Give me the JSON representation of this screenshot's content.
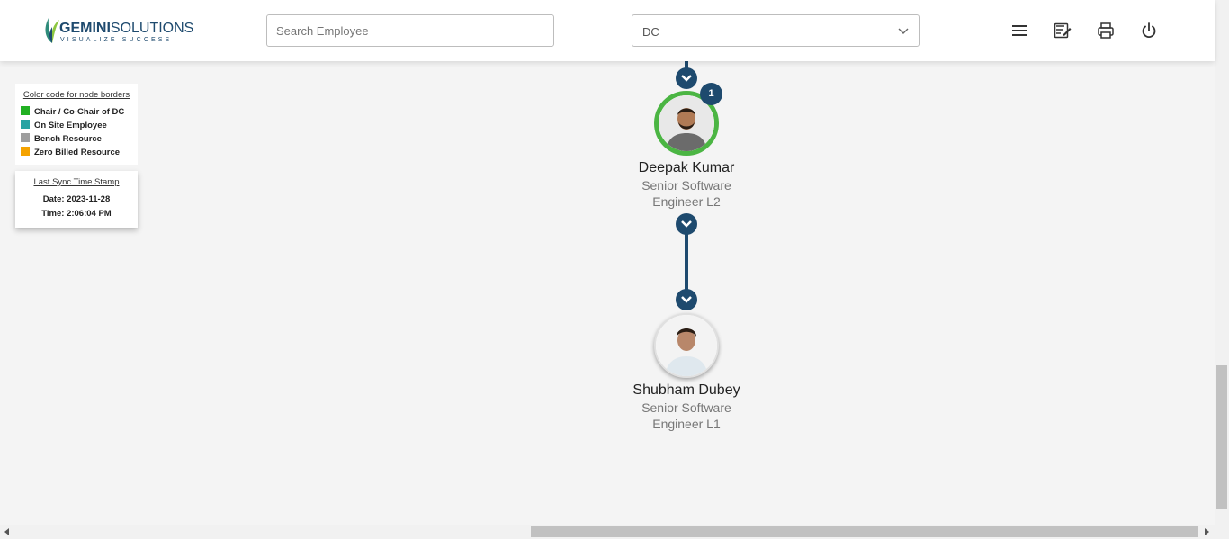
{
  "header": {
    "logo_main": "GEMINI",
    "logo_main2": "SOLUTIONS",
    "logo_sub": "VISUALIZE SUCCESS",
    "search_placeholder": "Search Employee",
    "search_value": "",
    "dc_select_value": "DC",
    "icons": [
      "menu-icon",
      "notes-icon",
      "print-icon",
      "power-icon"
    ]
  },
  "legend": {
    "title": "Color code for node borders",
    "items": [
      {
        "label": "Chair / Co-Chair of DC",
        "color": "#22b123"
      },
      {
        "label": "On Site Employee",
        "color": "#27a3a3"
      },
      {
        "label": "Bench Resource",
        "color": "#9e9e9e"
      },
      {
        "label": "Zero Billed Resource",
        "color": "#f5a300"
      }
    ]
  },
  "sync": {
    "title": "Last Sync Time Stamp",
    "date": "Date: 2023-11-28",
    "time": "Time: 2:06:04 PM"
  },
  "nodes": [
    {
      "name": "Deepak Kumar",
      "designation_line1": "Senior Software",
      "designation_line2": "Engineer L2",
      "badge": "1",
      "border_color": "#4bb543"
    },
    {
      "name": "Shubham Dubey",
      "designation_line1": "Senior Software",
      "designation_line2": "Engineer L1"
    }
  ],
  "colors": {
    "accent": "#1e4a6e",
    "chair_border": "#4bb543"
  }
}
